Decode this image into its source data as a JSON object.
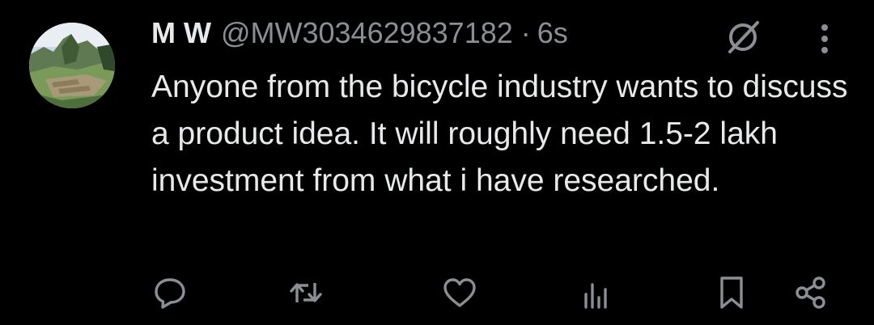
{
  "tweet": {
    "author_name": "M W",
    "handle": "@MW3034629837182",
    "separator": "·",
    "time": "6s",
    "text": "Anyone from the bicycle industry wants to discuss a product idea. It will roughly need 1.5-2 lakh investment from what i have researched."
  },
  "icons": {
    "avatar": "landscape-avatar",
    "mute": "mute-icon",
    "more": "more-vertical-icon",
    "actions": [
      "reply-icon",
      "retweet-icon",
      "like-icon",
      "views-icon",
      "bookmark-icon",
      "share-icon"
    ]
  },
  "colors": {
    "background": "#000000",
    "text": "#e7e9ea",
    "secondary": "#8b8f94"
  }
}
